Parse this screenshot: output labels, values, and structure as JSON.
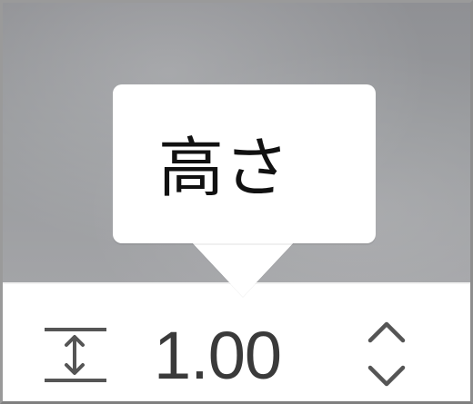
{
  "tooltip": {
    "text": "高さ"
  },
  "control": {
    "value": "1.00"
  },
  "icons": {
    "height": "height-icon",
    "increment": "chevron-up-icon",
    "decrement": "chevron-down-icon"
  }
}
